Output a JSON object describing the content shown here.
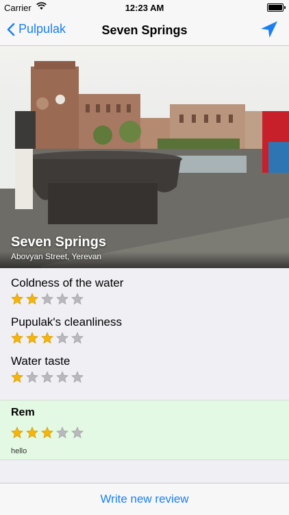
{
  "status_bar": {
    "carrier": "Carrier",
    "time": "12:23 AM"
  },
  "nav": {
    "back_label": "Pulpulak",
    "title": "Seven Springs"
  },
  "place": {
    "name": "Seven Springs",
    "address": "Abovyan Street, Yerevan"
  },
  "criteria": [
    {
      "label": "Coldness of the water",
      "rating": 2,
      "max": 5
    },
    {
      "label": "Pupulak's cleanliness",
      "rating": 3,
      "max": 5
    },
    {
      "label": "Water taste",
      "rating": 1,
      "max": 5
    }
  ],
  "review": {
    "author": "Rem",
    "rating": 3,
    "max": 5,
    "text": "hello"
  },
  "footer": {
    "write_review": "Write new review"
  },
  "colors": {
    "accent": "#1a7ef5",
    "star_filled": "#f5b50a",
    "star_empty": "#b9b9bd",
    "review_bg": "#e3f9e3"
  }
}
